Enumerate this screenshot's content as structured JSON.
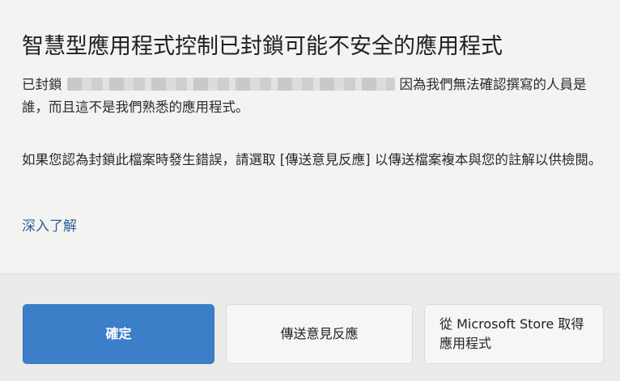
{
  "dialog": {
    "title": "智慧型應用程式控制已封鎖可能不安全的應用程式",
    "message_prefix": "已封鎖",
    "message_suffix": "因為我們無法確認撰寫的人員是誰，而且這不是我們熟悉的應用程式。",
    "feedback_text": "如果您認為封鎖此檔案時發生錯誤，請選取 [傳送意見反應] 以傳送檔案複本與您的註解以供檢閱。",
    "learn_more": "深入了解"
  },
  "buttons": {
    "ok": "確定",
    "send_feedback": "傳送意見反應",
    "get_from_store": "從 Microsoft Store 取得應用程式"
  },
  "colors": {
    "primary_button": "#3b7fc8",
    "link": "#2f5f9a",
    "background": "#f3f3f1"
  }
}
